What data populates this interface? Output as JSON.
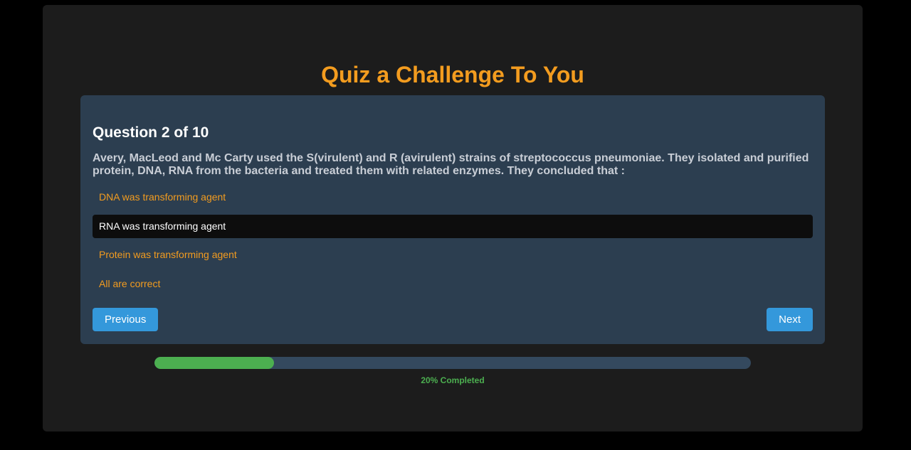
{
  "quiz": {
    "title": "Quiz a Challenge To You",
    "question_heading": "Question 2 of 10",
    "question_text": "Avery, MacLeod and Mc Carty used the S(virulent) and R (avirulent) strains of streptococcus pneumoniae. They isolated and purified protein, DNA, RNA from the bacteria and treated them with related enzymes. They concluded that :",
    "options": [
      {
        "label": "DNA was transforming agent",
        "selected": false
      },
      {
        "label": "RNA was transforming agent",
        "selected": true
      },
      {
        "label": "Protein was transforming agent",
        "selected": false
      },
      {
        "label": "All are correct",
        "selected": false
      }
    ],
    "previous_label": "Previous",
    "next_label": "Next"
  },
  "progress": {
    "percent": 20,
    "label": "20% Completed"
  },
  "colors": {
    "accent": "#f39c1f",
    "button": "#3498db",
    "progress": "#4caf50",
    "card": "#2c3e50"
  }
}
